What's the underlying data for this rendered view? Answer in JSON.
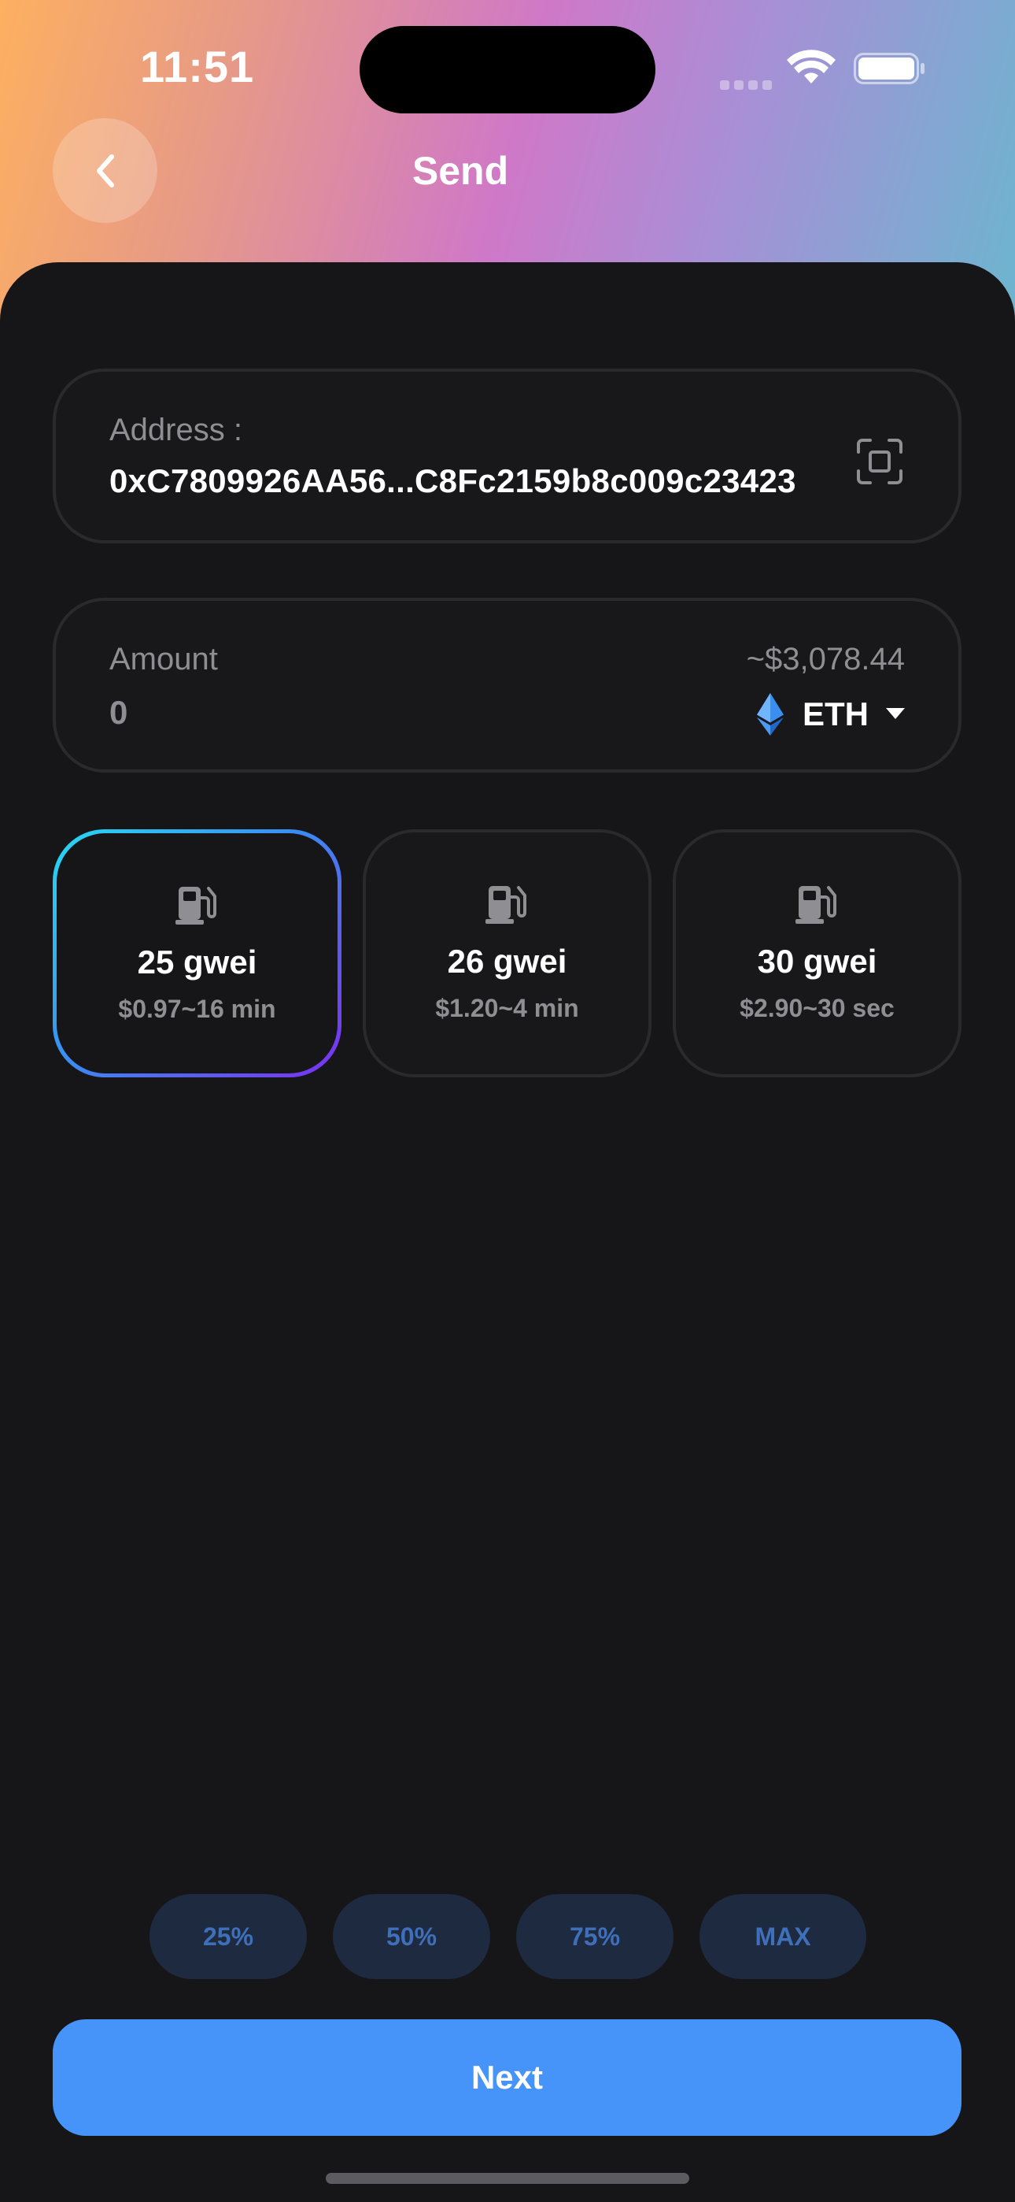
{
  "status_bar": {
    "time": "11:51"
  },
  "header": {
    "title": "Send",
    "back_icon": "chevron-left-icon"
  },
  "address_field": {
    "label": "Address :",
    "value": "0xC7809926AA56...C8Fc2159b8c009c23423",
    "scan_icon": "qr-scan-icon"
  },
  "amount_field": {
    "label": "Amount",
    "value": "0",
    "fiat_value": "~$3,078.44",
    "token": "ETH",
    "token_icon": "ethereum-icon"
  },
  "fee_options": [
    {
      "gwei": "25 gwei",
      "cost": "$0.97~16 min",
      "selected": true,
      "icon": "gas-pump-icon"
    },
    {
      "gwei": "26 gwei",
      "cost": "$1.20~4 min",
      "selected": false,
      "icon": "gas-pump-icon"
    },
    {
      "gwei": "30 gwei",
      "cost": "$2.90~30 sec",
      "selected": false,
      "icon": "gas-pump-icon"
    }
  ],
  "percent_buttons": [
    "25%",
    "50%",
    "75%",
    "MAX"
  ],
  "next_button": {
    "label": "Next"
  },
  "colors": {
    "background": "#161619",
    "accent": "#4693fa",
    "chip_bg": "#1d2a40",
    "chip_text": "#3f6fb8",
    "selected_gradient_start": "#27d9f4",
    "selected_gradient_end": "#7b2ff0"
  }
}
